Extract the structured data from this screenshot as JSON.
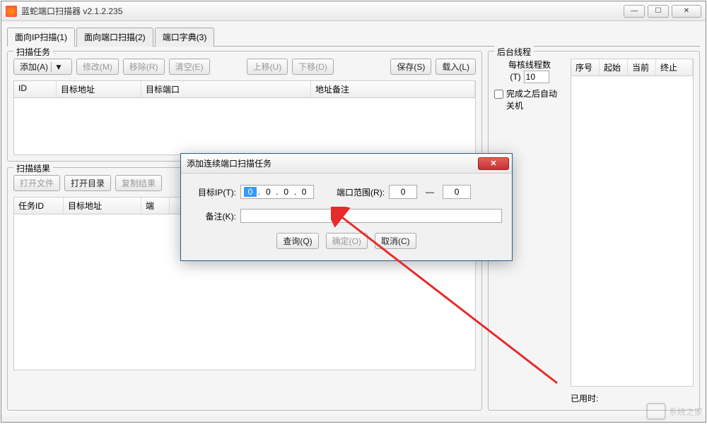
{
  "window": {
    "title": "蓝蛇端口扫描器 v2.1.2.235"
  },
  "tabs": [
    {
      "label": "面向IP扫描(1)"
    },
    {
      "label": "面向端口扫描(2)"
    },
    {
      "label": "端口字典(3)"
    }
  ],
  "scan_task": {
    "title": "扫描任务",
    "buttons": {
      "add": "添加(A)",
      "modify": "修改(M)",
      "remove": "移除(R)",
      "clear": "清空(E)",
      "move_up": "上移(U)",
      "move_down": "下移(D)",
      "save": "保存(S)",
      "load": "载入(L)"
    },
    "columns": {
      "id": "ID",
      "target_addr": "目标地址",
      "target_port": "目标端口",
      "addr_remark": "地址备注"
    }
  },
  "scan_result": {
    "title": "扫描结果",
    "buttons": {
      "open_file": "打开文件",
      "open_dir": "打开目录",
      "copy_result": "复制结果"
    },
    "columns": {
      "task_id": "任务ID",
      "target_addr": "目标地址",
      "port": "端"
    }
  },
  "bg_threads": {
    "title": "后台线程",
    "per_core_label": "每核线程数",
    "per_core_key": "(T)",
    "per_core_value": "10",
    "auto_shutdown": "完成之后自动关机",
    "columns": {
      "seq": "序号",
      "start": "起始",
      "current": "当前",
      "end": "终止"
    },
    "elapsed_label": "已用时:",
    "elapsed_value": ""
  },
  "dialog": {
    "title": "添加连续端口扫描任务",
    "target_ip_label": "目标IP(T):",
    "ip_octets": [
      "0",
      "0",
      "0",
      "0"
    ],
    "port_range_label": "端口范围(R):",
    "port_from": "0",
    "port_to": "0",
    "remark_label": "备注(K):",
    "remark_value": "",
    "buttons": {
      "query": "查询(Q)",
      "ok": "确定(O)",
      "cancel": "取消(C)"
    }
  },
  "watermark": "系统之家"
}
